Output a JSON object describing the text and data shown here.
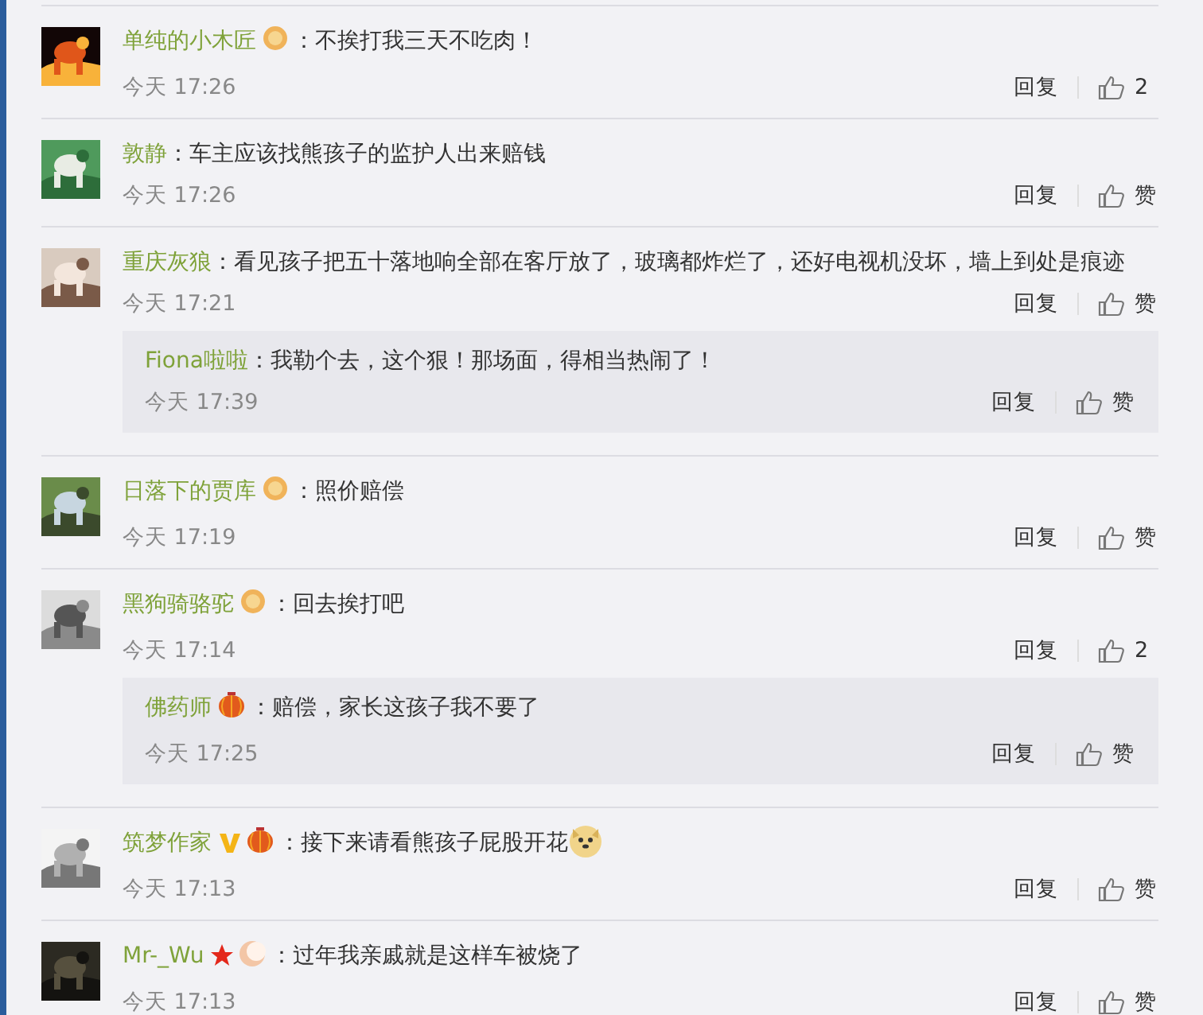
{
  "comments": [
    {
      "name": "单纯的小木匠",
      "badges": [
        {
          "kind": "medal"
        }
      ],
      "text": "：不挨打我三天不吃肉！",
      "time": "今天 17:26",
      "reply": "回复",
      "like": "2"
    },
    {
      "name": "敦静",
      "text": "：车主应该找熊孩子的监护人出来赔钱",
      "time": "今天 17:26",
      "reply": "回复",
      "like": "赞"
    },
    {
      "name": "重庆灰狼",
      "text": "：看见孩子把五十落地响全部在客厅放了，玻璃都炸烂了，还好电视机没坏，墙上到处是痕迹",
      "time": "今天 17:21",
      "reply": "回复",
      "like": "赞",
      "replies": [
        {
          "name": "Fiona啦啦",
          "text": "：我勒个去，这个狠！那场面，得相当热闹了！",
          "time": "今天 17:39",
          "reply": "回复",
          "like": "赞"
        }
      ]
    },
    {
      "name": "日落下的贾库",
      "badges": [
        {
          "kind": "medal"
        }
      ],
      "text": "：照价赔偿",
      "time": "今天 17:19",
      "reply": "回复",
      "like": "赞"
    },
    {
      "name": "黑狗骑骆驼",
      "badges": [
        {
          "kind": "medal"
        }
      ],
      "text": "：回去挨打吧",
      "time": "今天 17:14",
      "reply": "回复",
      "like": "2",
      "replies": [
        {
          "name": "佛药师",
          "badges": [
            {
              "kind": "lantern"
            }
          ],
          "text": "：赔偿，家长这孩子我不要了",
          "time": "今天 17:25",
          "reply": "回复",
          "like": "赞"
        }
      ]
    },
    {
      "name": "筑梦作家",
      "badges": [
        {
          "kind": "vip"
        },
        {
          "kind": "lantern"
        }
      ],
      "text": "：接下来请看熊孩子屁股开花",
      "emoji": {
        "kind": "doge"
      },
      "time": "今天 17:13",
      "reply": "回复",
      "like": "赞"
    },
    {
      "name": "Mr-_Wu",
      "badges": [
        {
          "kind": "star"
        },
        {
          "kind": "moon"
        }
      ],
      "text": "：过年我亲戚就是这样车被烧了",
      "time": "今天 17:13",
      "reply": "回复",
      "like": "赞"
    }
  ]
}
